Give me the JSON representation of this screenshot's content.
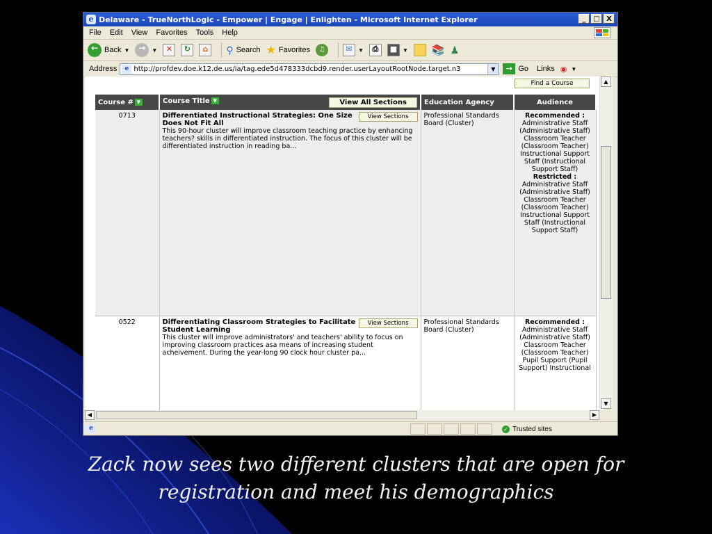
{
  "window": {
    "title": "Delaware - TrueNorthLogic - Empower | Engage | Enlighten - Microsoft Internet Explorer",
    "controls": [
      "_",
      "□",
      "X"
    ]
  },
  "menu": [
    "File",
    "Edit",
    "View",
    "Favorites",
    "Tools",
    "Help"
  ],
  "toolbar": {
    "back": "Back",
    "search": "Search",
    "favorites": "Favorites"
  },
  "address": {
    "label": "Address",
    "url": "http://profdev.doe.k12.de.us/ia/tag.ede5d478333dcbd9.render.userLayoutRootNode.target.n3",
    "go": "Go",
    "links": "Links"
  },
  "page": {
    "find_course": "Find a Course",
    "view_all_sections": "View All Sections",
    "view_sections": "View Sections",
    "columns": [
      "Course #",
      "Course Title",
      "Education Agency",
      "Audience"
    ],
    "rows": [
      {
        "number": "0713",
        "title": "Differentiated Instructional Strategies: One Size Does Not Fit All",
        "description": "This 90-hour cluster will improve classroom teaching practice by enhancing teachers? skills in differentiated instruction. The focus of this cluster will be differentiated instruction in reading ba...",
        "agency": "Professional Standards Board (Cluster)",
        "recommended_label": "Recommended :",
        "recommended": "Administrative Staff (Administrative Staff) Classroom Teacher (Classroom Teacher) Instructional Support Staff (Instructional Support Staff)",
        "restricted_label": "Restricted :",
        "restricted": "Administrative Staff (Administrative Staff) Classroom Teacher (Classroom Teacher) Instructional Support Staff (Instructional Support Staff)"
      },
      {
        "number": "0522",
        "title": "Differentiating Classroom Strategies to Facilitate Student Learning",
        "description": "This cluster will improve administrators' and teachers' ability to focus on improving classroom practices asa means of increasing student acheivement. During the year-long 90 clock hour cluster pa...",
        "agency": "Professional Standards Board (Cluster)",
        "recommended_label": "Recommended :",
        "recommended": "Administrative Staff (Administrative Staff) Classroom Teacher (Classroom Teacher) Pupil Support (Pupil Support) Instructional"
      }
    ]
  },
  "status": {
    "zone": "Trusted sites"
  },
  "caption": "Zack now sees two different clusters that are open for registration and meet his demographics",
  "colors": {
    "header_bg": "#474747",
    "row1_bg": "#eeeeee",
    "slide_bg": "#000000",
    "accent_blue": "#1c46b8"
  }
}
